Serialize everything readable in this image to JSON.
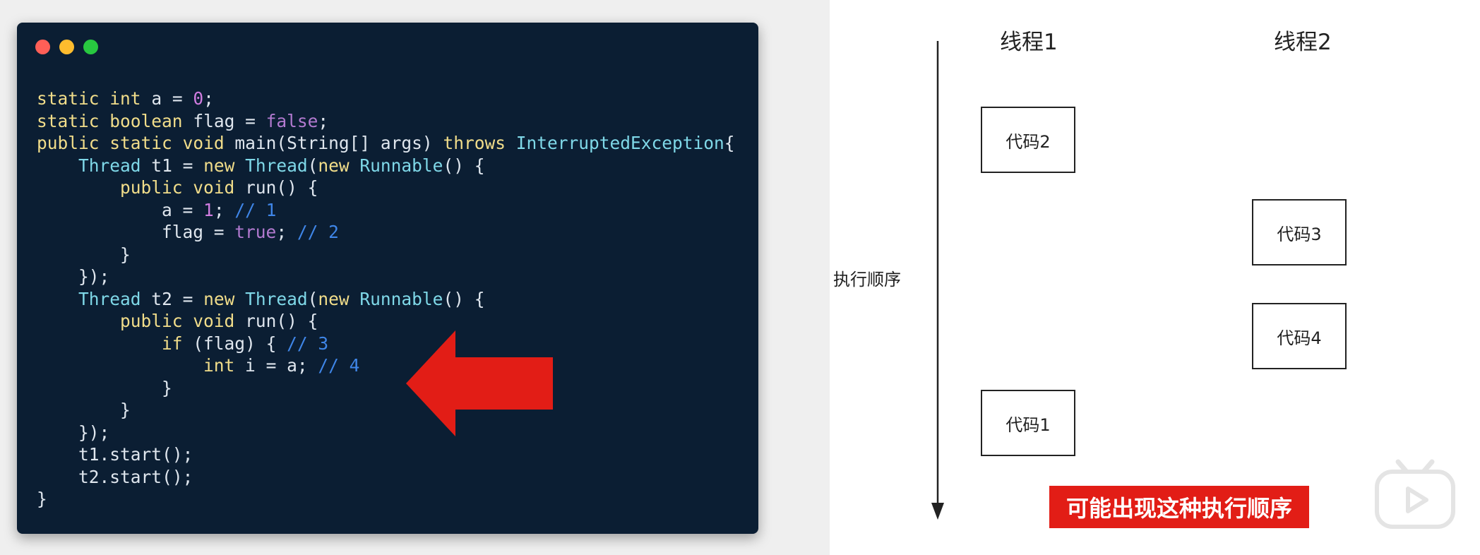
{
  "code_window": {
    "lines": [
      [
        {
          "t": "static int a = ",
          "c": "kw-first"
        },
        {
          "t": "0",
          "c": "num"
        },
        {
          "t": ";",
          "c": ""
        }
      ],
      [
        {
          "t": "static boolean flag = ",
          "c": ""
        },
        {
          "t": "false",
          "c": "bool"
        },
        {
          "t": ";",
          "c": ""
        }
      ],
      [
        {
          "t": "public static void main(String[] args) throws InterruptedException{",
          "c": ""
        }
      ],
      [
        {
          "t": "    Thread t1 = new Thread(new Runnable() {",
          "c": ""
        }
      ],
      [
        {
          "t": "        public void run() {",
          "c": ""
        }
      ],
      [
        {
          "t": "            a = ",
          "c": ""
        },
        {
          "t": "1",
          "c": "num"
        },
        {
          "t": "; ",
          "c": ""
        },
        {
          "t": "// 1",
          "c": "cmt"
        }
      ],
      [
        {
          "t": "            flag = ",
          "c": ""
        },
        {
          "t": "true",
          "c": "bool"
        },
        {
          "t": "; ",
          "c": ""
        },
        {
          "t": "// 2",
          "c": "cmt"
        }
      ],
      [
        {
          "t": "        }",
          "c": ""
        }
      ],
      [
        {
          "t": "    });",
          "c": ""
        }
      ],
      [
        {
          "t": "    Thread t2 = new Thread(new Runnable() {",
          "c": ""
        }
      ],
      [
        {
          "t": "        public void run() {",
          "c": ""
        }
      ],
      [
        {
          "t": "            if (flag) { ",
          "c": ""
        },
        {
          "t": "// 3",
          "c": "cmt"
        }
      ],
      [
        {
          "t": "                int i = a; ",
          "c": ""
        },
        {
          "t": "// 4",
          "c": "cmt"
        }
      ],
      [
        {
          "t": "            }",
          "c": ""
        }
      ],
      [
        {
          "t": "        }",
          "c": ""
        }
      ],
      [
        {
          "t": "    });",
          "c": ""
        }
      ],
      [
        {
          "t": "    t1.start();",
          "c": ""
        }
      ],
      [
        {
          "t": "    t2.start();",
          "c": ""
        }
      ],
      [
        {
          "t": "}",
          "c": ""
        }
      ]
    ]
  },
  "diagram": {
    "order_label": "执行顺序",
    "thread1_label": "线程1",
    "thread2_label": "线程2",
    "boxes": {
      "code2": "代码2",
      "code3": "代码3",
      "code4": "代码4",
      "code1": "代码1"
    },
    "banner": "可能出现这种执行顺序"
  },
  "colors": {
    "code_bg": "#0b1e33",
    "keyword": "#f1dd8a",
    "number": "#d07ce0",
    "comment": "#3f86e8",
    "class": "#7fd8e8",
    "arrow": "#e21d16",
    "banner_bg": "#e21d16"
  },
  "icons": {
    "play": "bilibili-play-icon",
    "window_controls": [
      "close-dot-icon",
      "minimize-dot-icon",
      "maximize-dot-icon"
    ]
  }
}
